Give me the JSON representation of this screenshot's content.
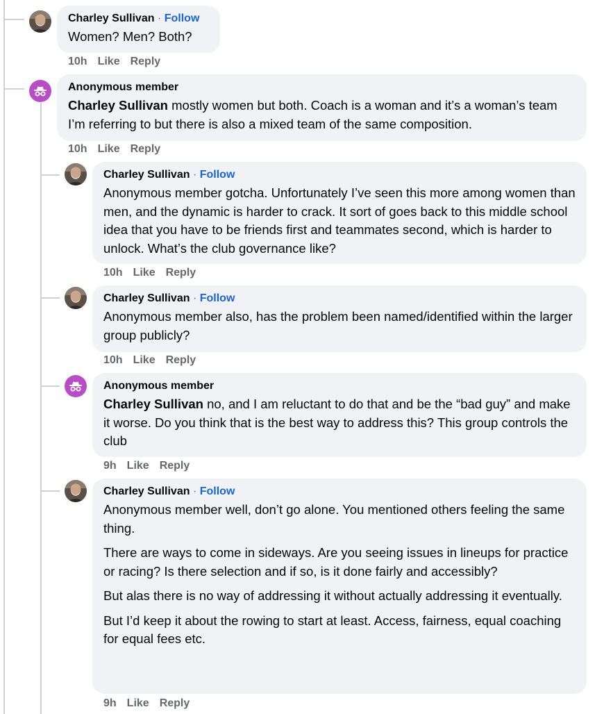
{
  "labels": {
    "follow": "Follow",
    "like": "Like",
    "reply": "Reply",
    "dot": "·"
  },
  "comments": [
    {
      "author": "Charley Sullivan",
      "avatar": "profile-photo",
      "time": "10h",
      "paragraphs": [
        {
          "text": "Women? Men? Both?"
        }
      ]
    },
    {
      "author": "Anonymous member",
      "avatar": "anonymous-icon",
      "time": "10h",
      "paragraphs": [
        {
          "mention": "Charley Sullivan",
          "text": " mostly women but both. Coach is a woman and it’s a woman’s team I’m referring to but there is also a mixed team of the same composition."
        }
      ]
    },
    {
      "author": "Charley Sullivan",
      "avatar": "profile-photo",
      "time": "10h",
      "paragraphs": [
        {
          "text": "Anonymous member gotcha. Unfortunately I’ve seen this more among women than men, and the dynamic is harder to crack. It sort of goes back to this middle school idea that you have to be friends first and teammates second, which is harder to unlock. What’s the club governance like?"
        }
      ]
    },
    {
      "author": "Charley Sullivan",
      "avatar": "profile-photo",
      "time": "10h",
      "paragraphs": [
        {
          "text": "Anonymous member also, has the problem been named/identified within the larger group publicly?"
        }
      ]
    },
    {
      "author": "Anonymous member",
      "avatar": "anonymous-icon",
      "time": "9h",
      "paragraphs": [
        {
          "mention": "Charley Sullivan",
          "text": " no, and I am reluctant to do that and be the “bad guy” and make it worse. Do you think that is the best way to address this? This group controls the club"
        }
      ]
    },
    {
      "author": "Charley Sullivan",
      "avatar": "profile-photo",
      "time": "9h",
      "paragraphs": [
        {
          "text": "Anonymous member well, don’t go alone. You mentioned others feeling the same thing."
        },
        {
          "text": "There are ways to come in sideways. Are you seeing issues in lineups for practice or racing? Is there selection and if so, is it done fairly and accessibly?"
        },
        {
          "text": "But alas there is no way of addressing it without actually addressing it eventually."
        },
        {
          "text": "But I’d keep it about the rowing to start at least. Access, fairness, equal coaching for equal fees etc."
        }
      ]
    }
  ]
}
